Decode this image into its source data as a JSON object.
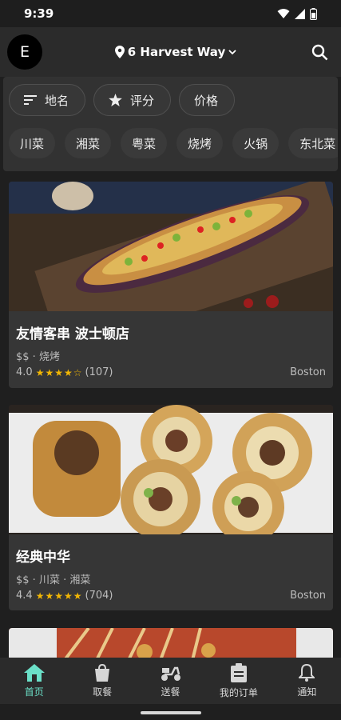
{
  "status": {
    "time": "9:39"
  },
  "header": {
    "avatar_letter": "E",
    "location": "6 Harvest Way"
  },
  "filters": {
    "primary": [
      {
        "label": "地名",
        "icon": "sort-icon"
      },
      {
        "label": "评分",
        "icon": "star-icon"
      },
      {
        "label": "价格"
      }
    ],
    "cuisines": [
      "川菜",
      "湘菜",
      "粤菜",
      "烧烤",
      "火锅",
      "东北菜"
    ]
  },
  "restaurants": [
    {
      "name": "友情客串 波士顿店",
      "meta": "$$ · 烧烤",
      "rating": "4.0",
      "stars": 4,
      "reviews": "(107)",
      "city": "Boston"
    },
    {
      "name": "经典中华",
      "meta": "$$ · 川菜 · 湘菜",
      "rating": "4.4",
      "stars": 4.5,
      "reviews": "(704)",
      "city": "Boston"
    }
  ],
  "nav": [
    {
      "label": "首页",
      "icon": "home-icon",
      "active": true
    },
    {
      "label": "取餐",
      "icon": "pickup-bag-icon"
    },
    {
      "label": "送餐",
      "icon": "scooter-icon"
    },
    {
      "label": "我的订单",
      "icon": "clipboard-icon"
    },
    {
      "label": "通知",
      "icon": "bell-icon"
    }
  ],
  "colors": {
    "accent": "#6be0c8",
    "star": "#f2b705",
    "background": "#1f1f1f",
    "card": "#363636"
  }
}
